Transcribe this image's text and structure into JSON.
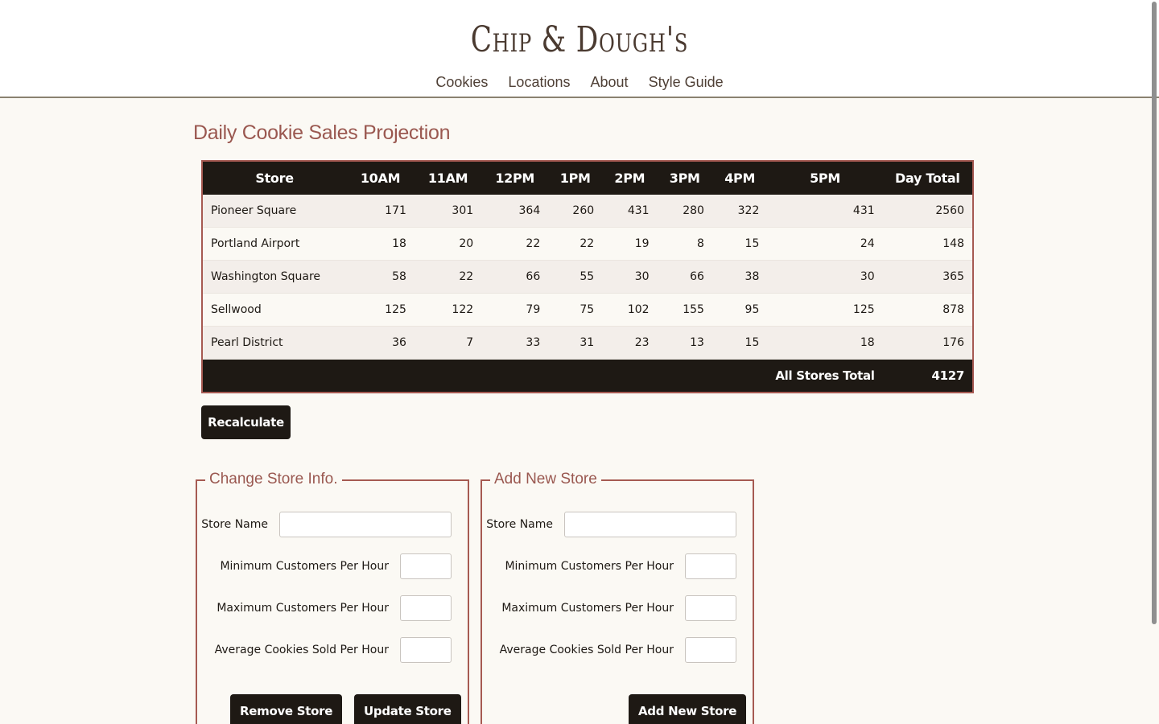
{
  "header": {
    "logo": "Chip & Dough's",
    "nav": [
      "Cookies",
      "Locations",
      "About",
      "Style Guide"
    ]
  },
  "main": {
    "title": "Daily Cookie Sales Projection"
  },
  "table": {
    "columns": [
      "Store",
      "10AM",
      "11AM",
      "12PM",
      "1PM",
      "2PM",
      "3PM",
      "4PM",
      "5PM",
      "Day Total"
    ],
    "rows": [
      {
        "store": "Pioneer Square",
        "hours": [
          171,
          301,
          364,
          260,
          431,
          280,
          322,
          431
        ],
        "total": 2560
      },
      {
        "store": "Portland Airport",
        "hours": [
          18,
          20,
          22,
          22,
          19,
          8,
          15,
          24
        ],
        "total": 148
      },
      {
        "store": "Washington Square",
        "hours": [
          58,
          22,
          66,
          55,
          30,
          66,
          38,
          30
        ],
        "total": 365
      },
      {
        "store": "Sellwood",
        "hours": [
          125,
          122,
          79,
          75,
          102,
          155,
          95,
          125
        ],
        "total": 878
      },
      {
        "store": "Pearl District",
        "hours": [
          36,
          7,
          33,
          31,
          23,
          13,
          15,
          18
        ],
        "total": 176
      }
    ],
    "footer_label": "All Stores Total",
    "footer_total": 4127
  },
  "actions": {
    "recalculate": "Recalculate"
  },
  "change_form": {
    "legend": "Change Store Info.",
    "store_name_label": "Store Name",
    "min_label": "Minimum Customers Per Hour",
    "max_label": "Maximum Customers Per Hour",
    "avg_label": "Average Cookies Sold Per Hour",
    "remove_button": "Remove Store",
    "update_button": "Update Store"
  },
  "add_form": {
    "legend": "Add New Store",
    "store_name_label": "Store Name",
    "min_label": "Minimum Customers Per Hour",
    "max_label": "Maximum Customers Per Hour",
    "avg_label": "Average Cookies Sold Per Hour",
    "add_button": "Add New Store"
  }
}
